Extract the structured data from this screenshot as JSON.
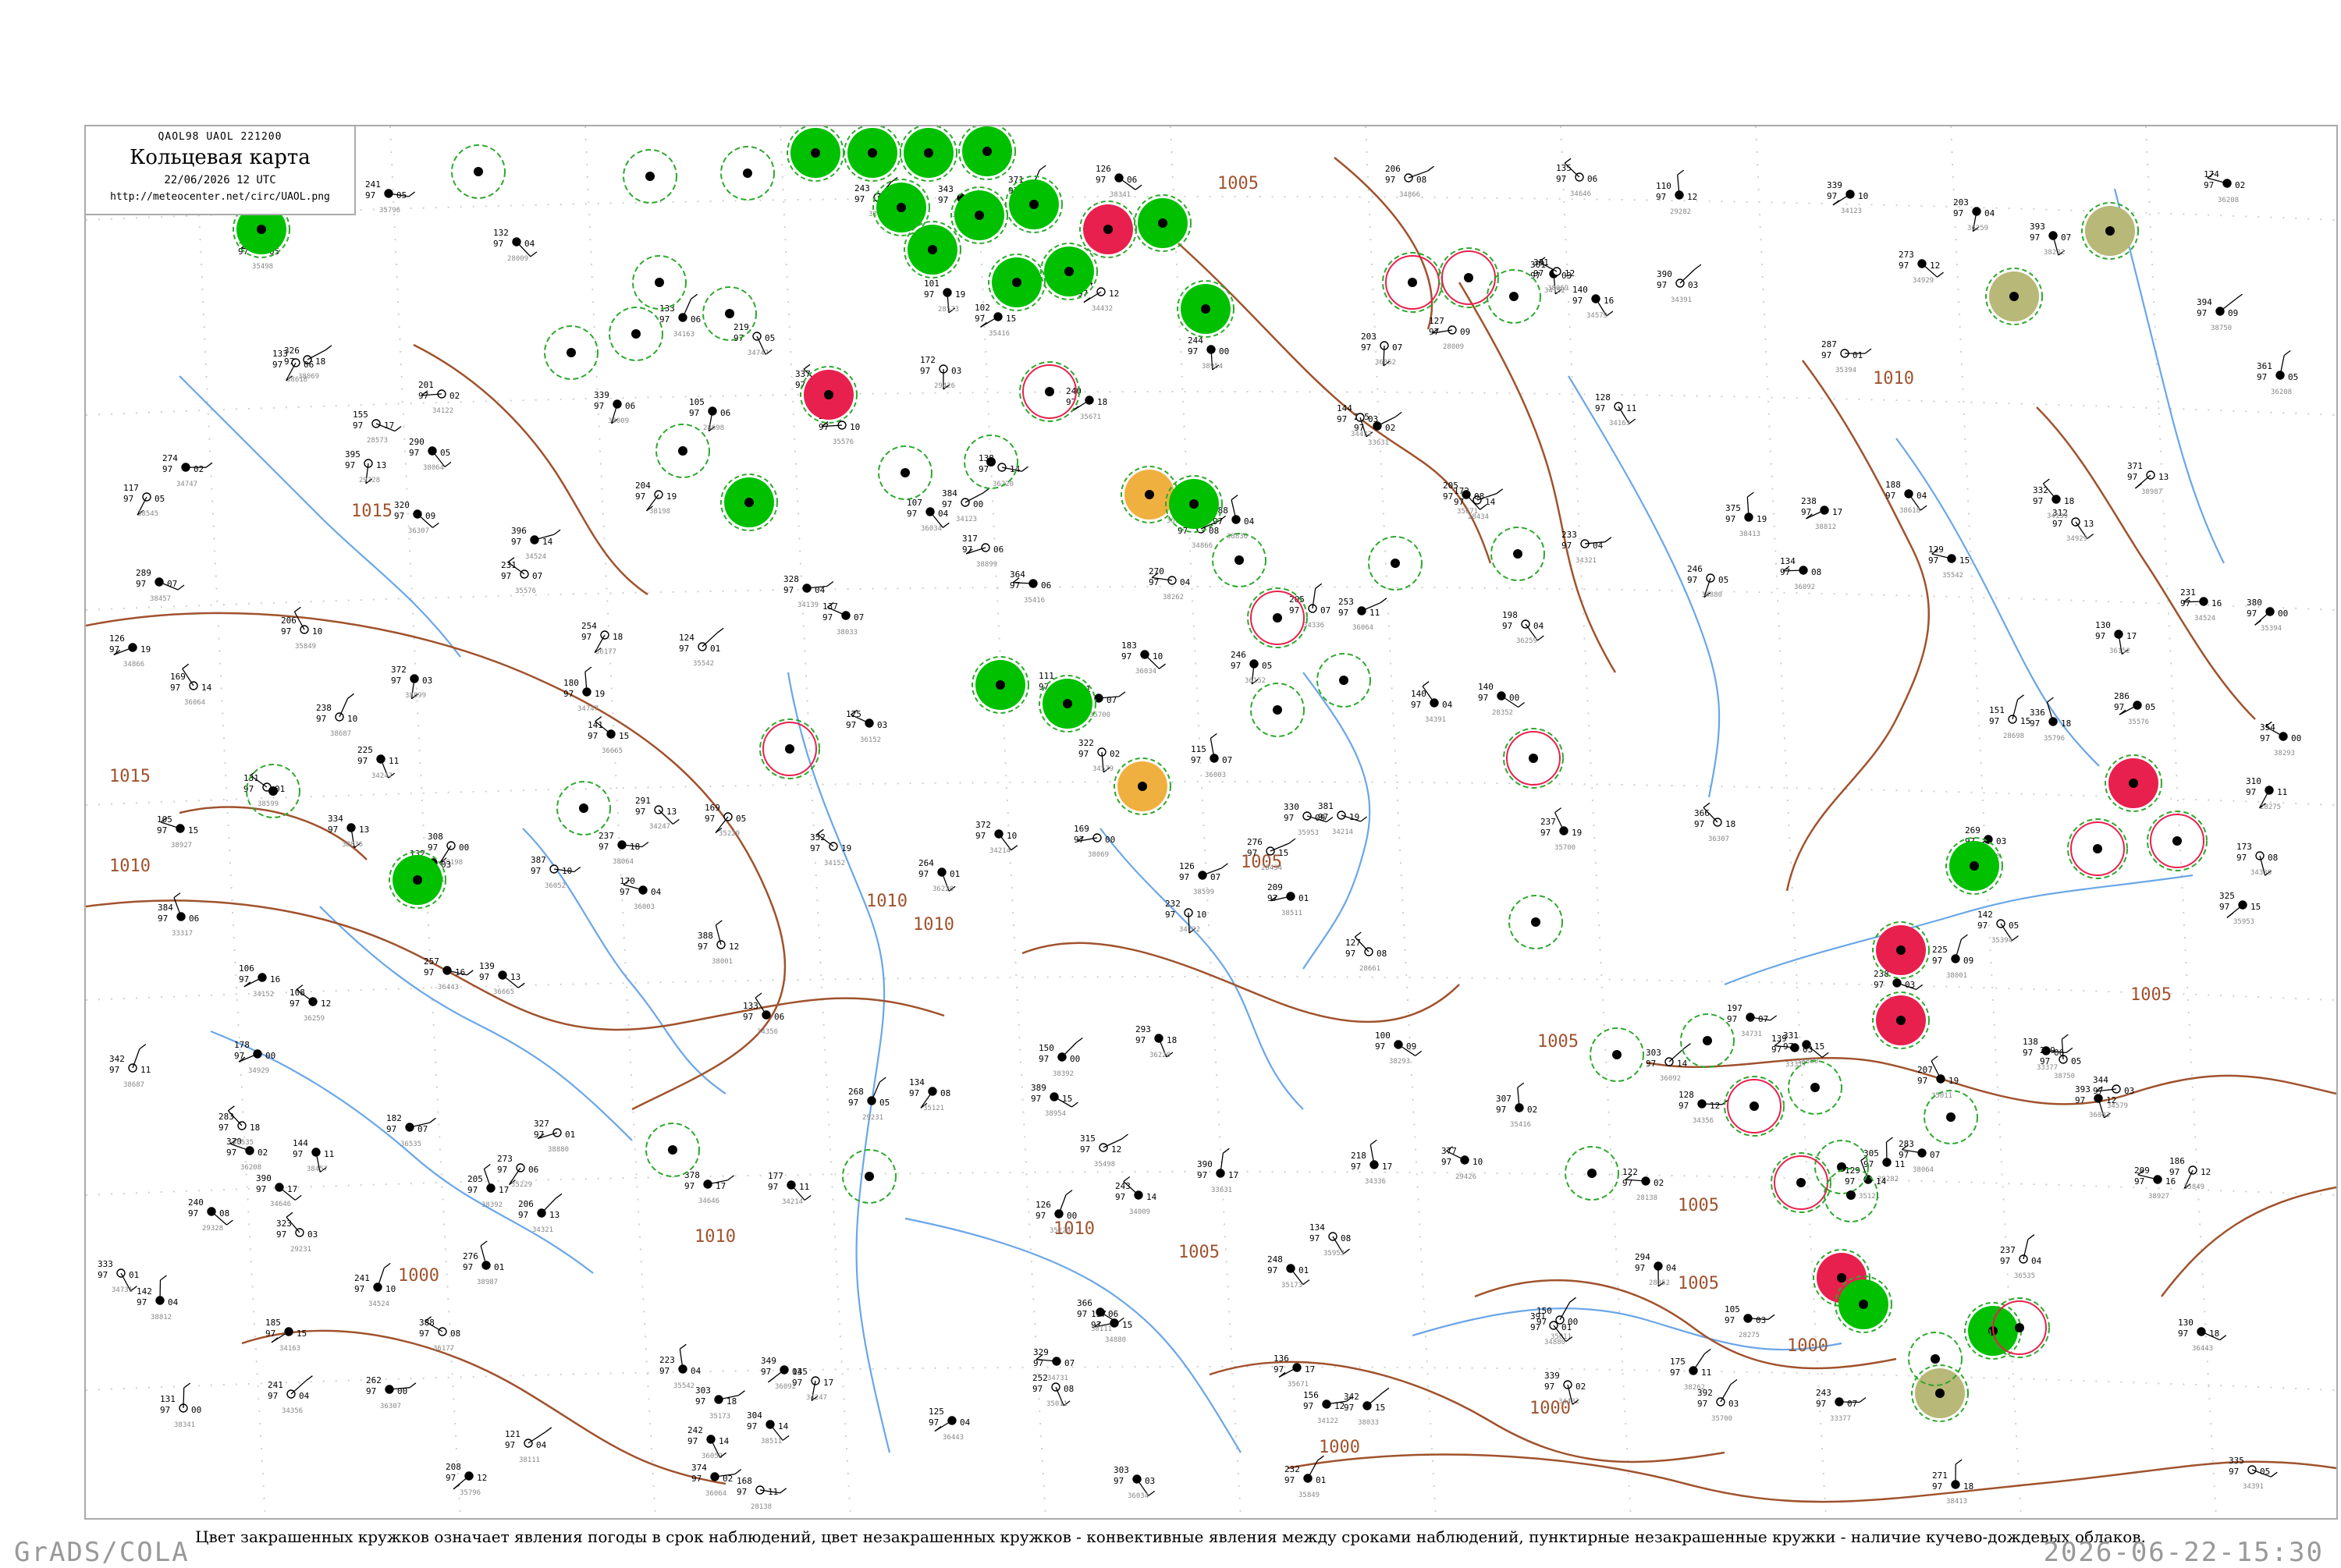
{
  "header": {
    "code_line": "QAOL98  UAOL  221200",
    "title": "Кольцевая карта",
    "date": "22/06/2026 12 UTC",
    "url": "http://meteocenter.net/circ/UAOL.png"
  },
  "caption": "Цвет закрашенных кружков означает явления погоды в срок наблюдений, цвет незакрашенных кружков - конвективные явления между сроками наблюдений, пунктирные незакрашенные кружки - наличие кучево-дождевых облаков.",
  "footer": {
    "left": "GrADS/COLA",
    "right": "2026-06-22-15:30"
  },
  "colors": {
    "isobar": "#a0522d",
    "river": "#6aa6e8",
    "rain": "#00c000",
    "thunderstorm": "#e8204e",
    "fog": "#f0b040",
    "haze": "#b8b878",
    "dashed_cb": "#2ea82e"
  },
  "isobar_labels": [
    "1015",
    "1010",
    "1005",
    "1000"
  ],
  "station_ids": [
    "34122",
    "34163",
    "34152",
    "34214",
    "34247",
    "34321",
    "34336",
    "34356",
    "34391",
    "34432",
    "34524",
    "34579",
    "34646",
    "34731",
    "34747",
    "34866",
    "34880",
    "34929",
    "35011",
    "35121",
    "35173",
    "35229",
    "35394",
    "35416",
    "35498",
    "35542",
    "35576",
    "35671",
    "35700",
    "35796",
    "35849",
    "35953",
    "36003",
    "36034",
    "36052",
    "36064",
    "36092",
    "36152",
    "36177",
    "36208",
    "36220",
    "36259",
    "36307",
    "36443",
    "36535",
    "36665",
    "38001",
    "38033",
    "38064",
    "38069",
    "38111",
    "38198",
    "38232",
    "38262",
    "38293",
    "38341",
    "38392",
    "38413",
    "38457",
    "38511",
    "38545",
    "38599",
    "38618",
    "38687",
    "38750",
    "38812",
    "38836",
    "38880",
    "38899",
    "38927",
    "38954",
    "38987",
    "28698",
    "28661",
    "28573",
    "28434",
    "28352",
    "28275",
    "28138",
    "28009",
    "33317",
    "33377",
    "33631",
    "34009",
    "34123",
    "34139",
    "29231",
    "29282",
    "29328",
    "29426"
  ]
}
